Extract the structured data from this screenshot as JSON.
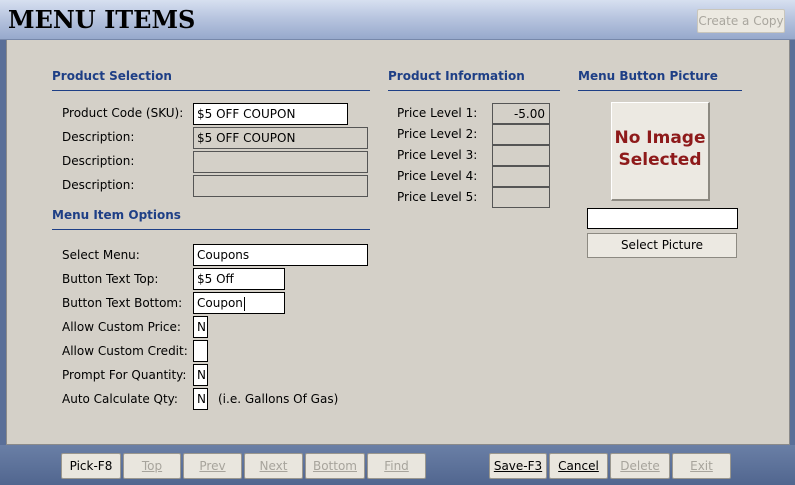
{
  "header": {
    "title": "MENU ITEMS",
    "copy_label": "Create a Copy"
  },
  "product_selection": {
    "title": "Product Selection",
    "sku_label": "Product Code (SKU):",
    "sku_value": "$5 OFF COUPON",
    "desc_label": "Description:",
    "desc1": "$5 OFF COUPON",
    "desc2": "",
    "desc3": ""
  },
  "item_options": {
    "title": "Menu Item Options",
    "select_menu_label": "Select Menu:",
    "select_menu_value": "Coupons",
    "text_top_label": "Button Text Top:",
    "text_top_value": "$5 Off",
    "text_bottom_label": "Button Text Bottom:",
    "text_bottom_value": "Coupon",
    "custom_price_label": "Allow Custom Price:",
    "custom_price_value": "N",
    "custom_credit_label": "Allow Custom Credit:",
    "custom_credit_value": "",
    "prompt_qty_label": "Prompt For Quantity:",
    "prompt_qty_value": "N",
    "auto_calc_label": "Auto Calculate Qty:",
    "auto_calc_value": "N",
    "auto_calc_hint": "(i.e. Gallons Of Gas)"
  },
  "product_info": {
    "title": "Product Information",
    "levels": [
      {
        "label": "Price Level 1:",
        "value": "-5.00"
      },
      {
        "label": "Price Level 2:",
        "value": ""
      },
      {
        "label": "Price Level 3:",
        "value": ""
      },
      {
        "label": "Price Level 4:",
        "value": ""
      },
      {
        "label": "Price Level 5:",
        "value": ""
      }
    ]
  },
  "picture": {
    "title": "Menu Button Picture",
    "no_image_line1": "No Image",
    "no_image_line2": "Selected",
    "path_value": "",
    "select_label": "Select Picture"
  },
  "footer": {
    "pick": "Pick-F8",
    "top": "Top",
    "prev": "Prev",
    "next": "Next",
    "bottom": "Bottom",
    "find": "Find",
    "save": "Save-F3",
    "cancel": "Cancel",
    "delete": "Delete",
    "exit": "Exit"
  },
  "colors": {
    "section_title": "#1e3f86",
    "no_image_text": "#8e1a1a",
    "panel_bg": "#d4d0c8"
  }
}
